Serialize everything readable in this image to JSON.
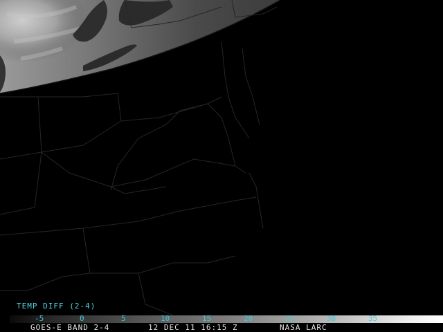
{
  "legend": {
    "title": "TEMP DIFF (2-4)",
    "ticks": [
      "-5",
      "0",
      "5",
      "10",
      "15",
      "20",
      "25",
      "30",
      "35"
    ]
  },
  "footer": {
    "satellite": "GOES-E BAND 2-4",
    "datetime": "12 DEC 11 16:15 Z",
    "source": "NASA LARC"
  },
  "colors": {
    "legend_text": "#46c8d8",
    "footer_text": "#e6e6e6",
    "background": "#000000",
    "borders": "#2a2a2a"
  }
}
